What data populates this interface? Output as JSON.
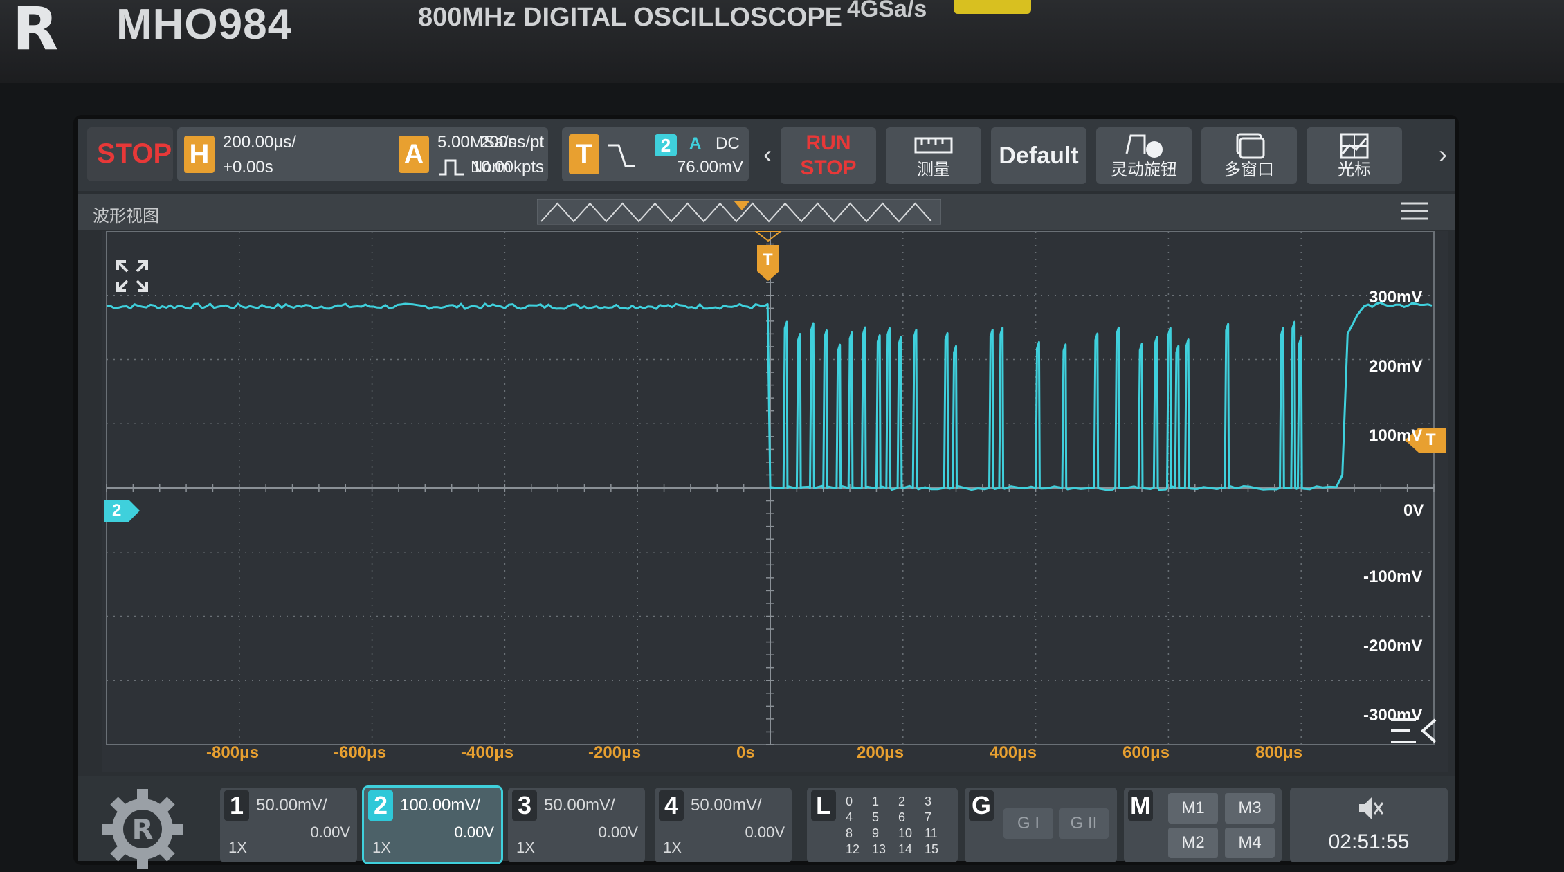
{
  "device": {
    "logo": "R",
    "model": "MHO984",
    "description": "800MHz DIGITAL OSCILLOSCOPE",
    "sample_rate": "4GSa/s"
  },
  "status": {
    "run_state": "STOP",
    "horizontal": {
      "letter": "H",
      "timebase": "200.00μs/",
      "offset": "+0.00s"
    },
    "acquire": {
      "letter": "A",
      "sample_rate": "5.00MSa/s",
      "mode": "Norm",
      "time_per_point": "200ns/pt",
      "depth": "10.00kpts"
    },
    "trigger": {
      "letter": "T",
      "source": "2",
      "coupling_a": "A",
      "coupling": "DC",
      "level": "76.00mV"
    }
  },
  "toolbar": {
    "run_label_1": "RUN",
    "run_label_2": "STOP",
    "measure_label": "测量",
    "default_label": "Default",
    "knob_label": "灵动旋钮",
    "multiwin_label": "多窗口",
    "cursor_label": "光标"
  },
  "waveform": {
    "title": "波形视图",
    "trigger_marker": "T",
    "channel_marker": "2",
    "trigger_level_marker": "T",
    "volt_labels": [
      "300mV",
      "200mV",
      "100mV",
      "0V",
      "-100mV",
      "-200mV",
      "-300mV"
    ],
    "time_labels": [
      "-800μs",
      "-600μs",
      "-400μs",
      "-200μs",
      "0s",
      "200μs",
      "400μs",
      "600μs",
      "800μs"
    ],
    "trace_color": "#3fd0dc"
  },
  "channels": [
    {
      "num": "1",
      "scale": "50.00mV/",
      "offset": "0.00V",
      "probe": "1X"
    },
    {
      "num": "2",
      "scale": "100.00mV/",
      "offset": "0.00V",
      "probe": "1X"
    },
    {
      "num": "3",
      "scale": "50.00mV/",
      "offset": "0.00V",
      "probe": "1X"
    },
    {
      "num": "4",
      "scale": "50.00mV/",
      "offset": "0.00V",
      "probe": "1X"
    }
  ],
  "logic": {
    "letter": "L",
    "bits": [
      "0",
      "1",
      "2",
      "3",
      "4",
      "5",
      "6",
      "7",
      "8",
      "9",
      "10",
      "11",
      "12",
      "13",
      "14",
      "15"
    ]
  },
  "generator": {
    "letter": "G",
    "g1": "G I",
    "g2": "G II"
  },
  "math": {
    "letter": "M",
    "m1": "M1",
    "m2": "M2",
    "m3": "M3",
    "m4": "M4"
  },
  "clock": {
    "time": "02:51:55"
  },
  "colors": {
    "accent": "#e8a030",
    "stop": "#e83838",
    "channel2": "#3fd0dc"
  }
}
